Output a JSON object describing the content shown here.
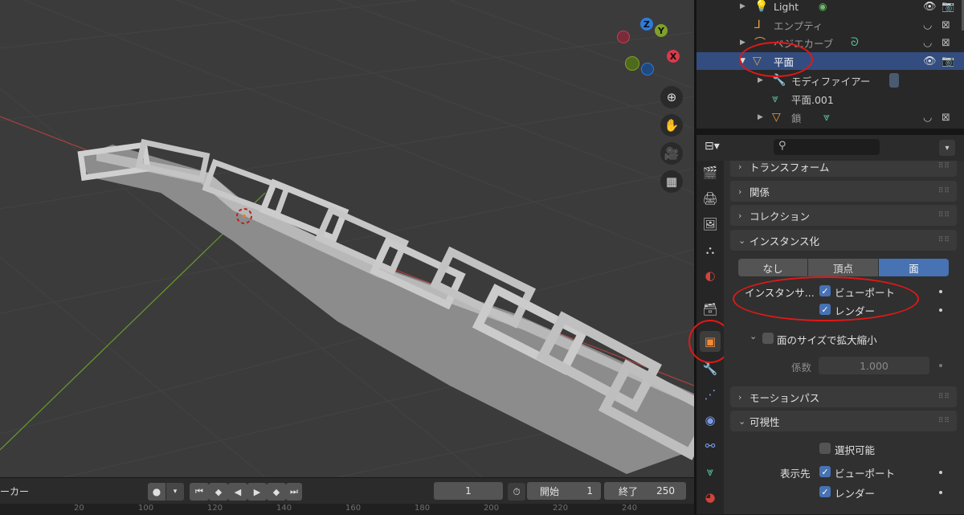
{
  "colors": {
    "accent": "#4772b3",
    "selected_row": "#334d80",
    "annotation": "#e01818",
    "axis_x": "#b04040",
    "axis_y": "#6a9a2a"
  },
  "gizmo": {
    "z": "Z",
    "y": "Y",
    "x": "X"
  },
  "nav_buttons": [
    "zoom-icon",
    "hand-icon",
    "camera-icon",
    "grid-icon"
  ],
  "outliner": {
    "rows": [
      {
        "label": "Light",
        "icon": "light-icon",
        "selected": false
      },
      {
        "label": "エンプティ",
        "icon": "empty-icon",
        "selected": false
      },
      {
        "label": "ベジエカーブ",
        "icon": "curve-icon",
        "selected": false
      },
      {
        "label": "平面",
        "icon": "mesh-icon",
        "selected": true
      },
      {
        "label": "モディファイアー",
        "icon": "wrench-icon",
        "selected": false
      },
      {
        "label": "平面.001",
        "icon": "mesh-data-icon",
        "selected": false
      },
      {
        "label": "鎖",
        "icon": "mesh-icon",
        "selected": false
      }
    ]
  },
  "properties": {
    "search_placeholder": "",
    "panels": {
      "transform": "トランスフォーム",
      "relations": "関係",
      "collections": "コレクション",
      "instancing": "インスタンス化",
      "motion_paths": "モーションパス",
      "visibility": "可視性"
    },
    "instancing": {
      "options": [
        "なし",
        "頂点",
        "面"
      ],
      "selected": "面",
      "instancer_label": "インスタンサ...",
      "viewport_label": "ビューポート",
      "render_label": "レンダー",
      "scale_by_face_label": "面のサイズで拡大縮小",
      "factor_label": "係数",
      "factor_value": "1.000"
    },
    "visibility": {
      "selectable_label": "選択可能",
      "show_in_label": "表示先",
      "viewport_label": "ビューポート",
      "render_label": "レンダー"
    }
  },
  "timeline": {
    "marker_label": "ーカー",
    "current_frame": "1",
    "start_label": "開始",
    "start_value": "1",
    "end_label": "終了",
    "end_value": "250",
    "ruler": [
      "20",
      "100",
      "120",
      "140",
      "160",
      "180",
      "200",
      "220",
      "240"
    ]
  }
}
